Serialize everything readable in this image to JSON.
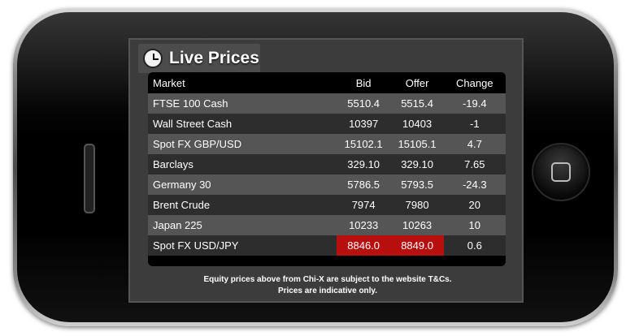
{
  "app": {
    "title": "Live Prices",
    "icons": {
      "title_icon": "clock-icon",
      "home": "home-button-icon"
    },
    "colors": {
      "alert_red": "#b70e0e",
      "row_light": "#555555",
      "row_dark": "#2d2d2d"
    }
  },
  "table": {
    "headers": {
      "market": "Market",
      "bid": "Bid",
      "offer": "Offer",
      "change": "Change"
    },
    "rows": [
      {
        "market": "FTSE 100 Cash",
        "bid": "5510.4",
        "offer": "5515.4",
        "change": "-19.4"
      },
      {
        "market": "Wall Street Cash",
        "bid": "10397",
        "offer": "10403",
        "change": "-1"
      },
      {
        "market": "Spot FX GBP/USD",
        "bid": "15102.1",
        "offer": "15105.1",
        "change": "4.7"
      },
      {
        "market": "Barclays",
        "bid": "329.10",
        "offer": "329.10",
        "change": "7.65"
      },
      {
        "market": "Germany 30",
        "bid": "5786.5",
        "offer": "5793.5",
        "change": "-24.3"
      },
      {
        "market": "Brent Crude",
        "bid": "7974",
        "offer": "7980",
        "change": "20"
      },
      {
        "market": "Japan 225",
        "bid": "10233",
        "offer": "10263",
        "change": "10"
      },
      {
        "market": "Spot FX USD/JPY",
        "bid": "8846.0",
        "offer": "8849.0",
        "change": "0.6",
        "highlight": [
          "bid",
          "offer"
        ]
      }
    ]
  },
  "footer": {
    "line1": "Equity prices above from Chi-X are subject to the website T&Cs.",
    "line2": "Prices are indicative only."
  }
}
